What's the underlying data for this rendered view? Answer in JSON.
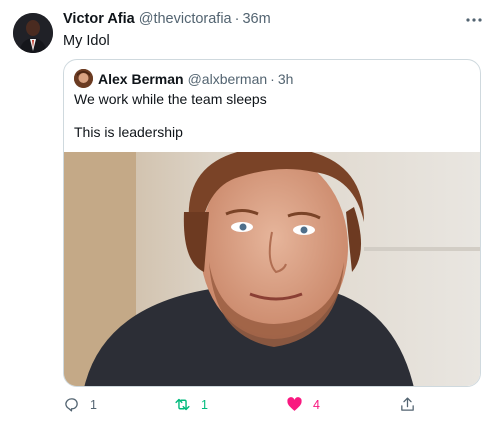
{
  "tweet": {
    "author_name": "Victor Afia",
    "author_handle": "@thevictorafia",
    "separator": "·",
    "time": "36m",
    "text": "My Idol"
  },
  "quoted_tweet": {
    "author_name": "Alex Berman",
    "author_handle": "@alxberman",
    "separator": "·",
    "time": "3h",
    "text_line_1": "We work while the team sleeps",
    "text_line_2": "This is leadership"
  },
  "actions": {
    "reply_count": "1",
    "retweet_count": "1",
    "like_count": "4"
  },
  "colors": {
    "retweet_active": "#00ba7c",
    "like_active": "#f91880",
    "secondary_text": "#536471",
    "border": "#cfd9de"
  },
  "icons": [
    "more-icon",
    "reply-icon",
    "retweet-icon",
    "like-icon",
    "share-icon"
  ]
}
